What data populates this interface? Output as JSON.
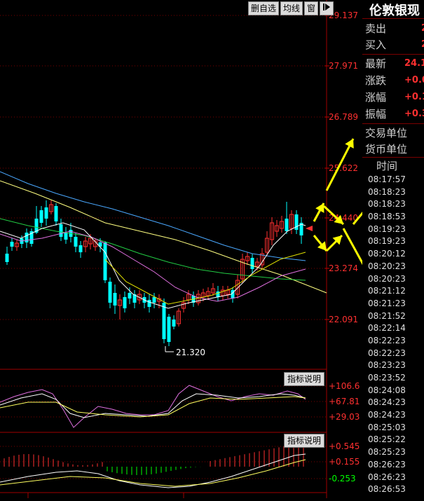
{
  "toolbar": {
    "delete_btn": "删自选",
    "ma_btn": "均线",
    "window_btn": "窗",
    "play_icon": "play-arrow-icon"
  },
  "price_axis": [
    "29.137",
    "27.971",
    "26.789",
    "25.622",
    "24.440",
    "23.274",
    "22.091"
  ],
  "low_marker": "21.320",
  "indicator1": {
    "label": "指标说明",
    "axis": [
      "+106.6",
      "+67.81",
      "+29.03"
    ]
  },
  "indicator2": {
    "label": "指标说明",
    "axis": [
      "+0.545",
      "+0.155",
      "-0.253"
    ]
  },
  "colors": {
    "up": "#ff3030",
    "down": "#00ffff",
    "background": "#000000",
    "arrow": "#ffff00"
  },
  "panel": {
    "title": "伦敦银现",
    "rows": [
      {
        "label": "卖出",
        "value": "2"
      },
      {
        "label": "买入",
        "value": "2"
      },
      {
        "label": "最新",
        "value": "24.1"
      },
      {
        "label": "涨跌",
        "value": "+0.0"
      },
      {
        "label": "涨幅",
        "value": "+0.1"
      },
      {
        "label": "振幅",
        "value": "+0.3"
      }
    ],
    "trade_unit": "交易单位",
    "currency_unit": "货币单位",
    "time_header": "时间",
    "times": [
      "08:17:57",
      "08:18:23",
      "08:18:23",
      "08:18:53",
      "08:19:23",
      "08:19:23",
      "08:20:12",
      "08:20:23",
      "08:20:23",
      "08:21:12",
      "08:21:23",
      "08:21:52",
      "08:22:14",
      "08:22:23",
      "08:22:23",
      "08:23:23",
      "08:23:52",
      "08:24:08",
      "08:24:23",
      "08:24:23",
      "08:25:03",
      "08:25:22",
      "08:25:23",
      "08:26:23",
      "08:26:23",
      "08:26:53"
    ]
  }
}
